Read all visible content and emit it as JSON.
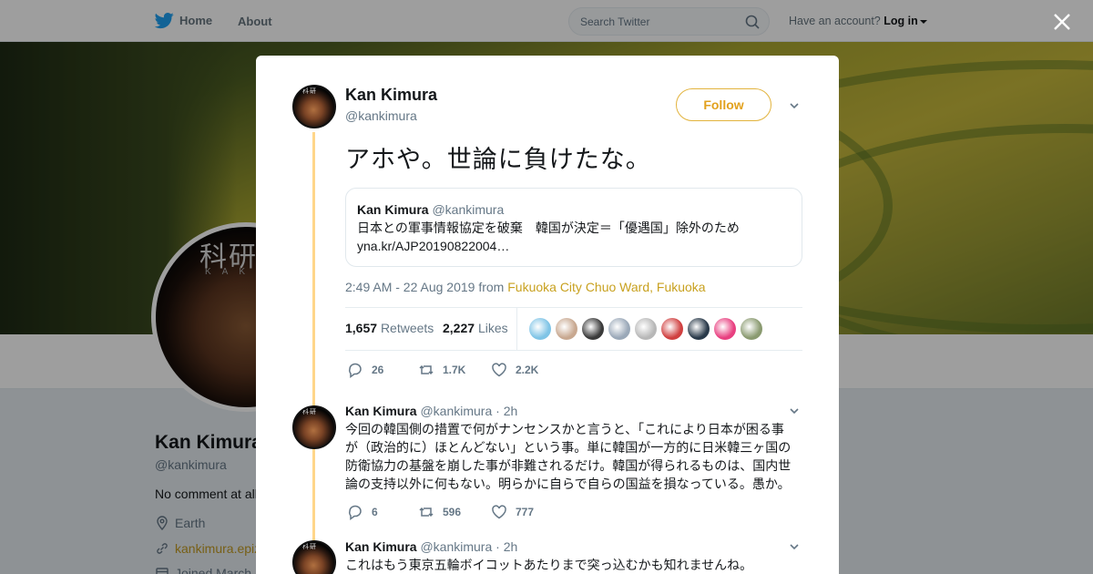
{
  "nav": {
    "home": "Home",
    "about": "About",
    "search_placeholder": "Search Twitter",
    "have_account": "Have an account?",
    "login": "Log in"
  },
  "profile": {
    "avatar_kanji": "科研",
    "avatar_sub": "KAKE",
    "name": "Kan Kimura",
    "handle": "@kankimura",
    "bio": "No comment at all",
    "location": "Earth",
    "website": "kankimura.epiz",
    "joined": "Joined March"
  },
  "tweet": {
    "name": "Kan Kimura",
    "handle": "@kankimura",
    "follow_label": "Follow",
    "text": "アホや。世論に負けたな。",
    "quote": {
      "name": "Kan Kimura",
      "handle": "@kankimura",
      "line1": "日本との軍事情報協定を破棄　韓国が決定＝「優遇国」除外のため",
      "line2": "yna.kr/AJP20190822004…"
    },
    "time": "2:49 AM - 22 Aug 2019 from",
    "place": "Fukuoka City Chuo Ward, Fukuoka",
    "retweets_count": "1,657",
    "retweets_label": "Retweets",
    "likes_count": "2,227",
    "likes_label": "Likes",
    "likers": [
      "#7fc4e6",
      "#c8a890",
      "#3a3a3a",
      "#9aa8b8",
      "#b8b8b8",
      "#d04040",
      "#2a3a4a",
      "#e84080",
      "#8a9a70"
    ],
    "actions": {
      "replies": "26",
      "retweets": "1.7K",
      "likes": "2.2K"
    }
  },
  "replies": [
    {
      "name": "Kan Kimura",
      "handle": "@kankimura",
      "time": "· 2h",
      "lines": [
        "今回の韓国側の措置で何がナンセンスかと言うと、「これにより日本が困る事",
        "が（政治的に）ほとんどない」という事。単に韓国が一方的に日米韓三ヶ国の",
        "防衛協力の基盤を崩した事が非難されるだけ。韓国が得られるものは、国内世",
        "論の支持以外に何もない。明らかに自らで自らの国益を損なっている。愚か。"
      ],
      "actions": {
        "replies": "6",
        "retweets": "596",
        "likes": "777"
      }
    },
    {
      "name": "Kan Kimura",
      "handle": "@kankimura",
      "time": "· 2h",
      "lines": [
        "これはもう東京五輪ボイコットあたりまで突っ込むかも知れませんね。"
      ]
    }
  ]
}
